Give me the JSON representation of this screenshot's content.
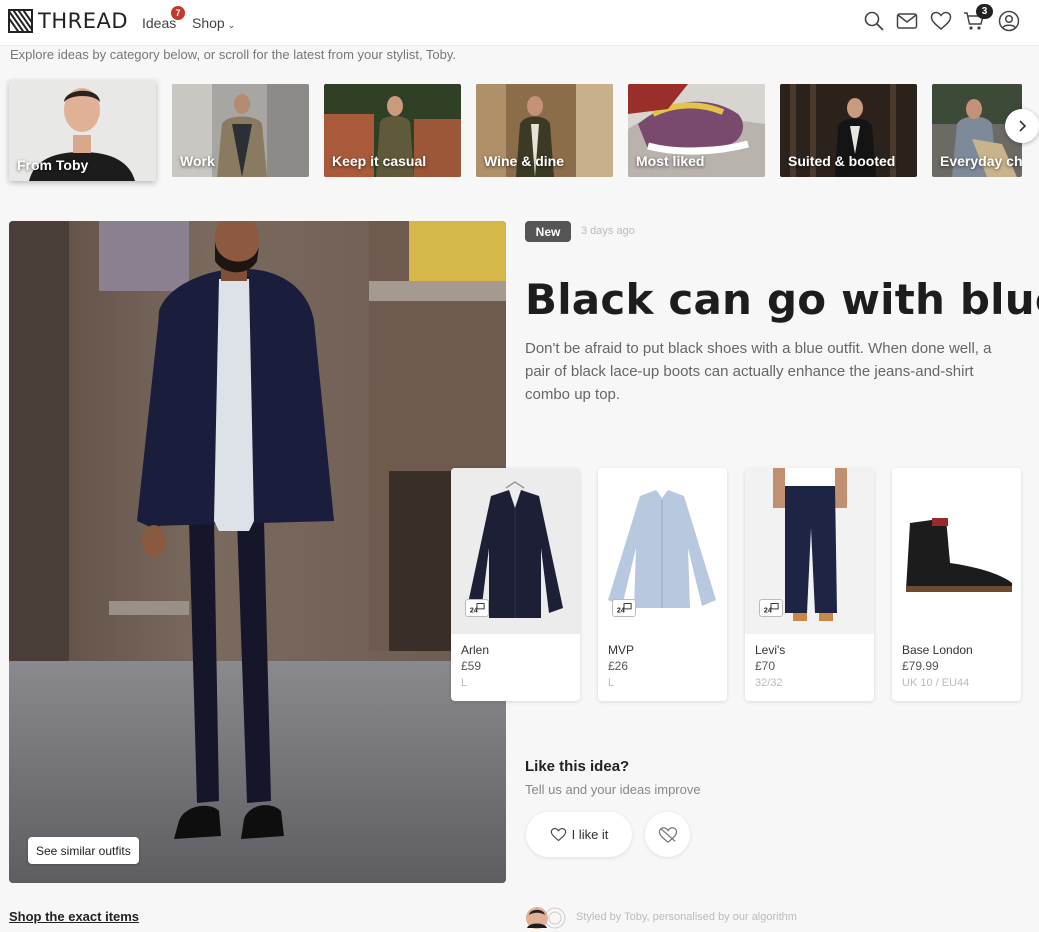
{
  "header": {
    "logo_text": "THREAD",
    "nav": {
      "ideas_label": "Ideas",
      "ideas_badge": "7",
      "shop_label": "Shop"
    },
    "icons": [
      "search-icon",
      "mail-icon",
      "heart-icon",
      "cart-icon",
      "account-icon"
    ],
    "cart_count": "3"
  },
  "subtext": "Explore ideas by category below, or scroll for the latest from your stylist, Toby.",
  "categories": [
    {
      "label": "From Toby"
    },
    {
      "label": "Work"
    },
    {
      "label": "Keep it casual"
    },
    {
      "label": "Wine & dine"
    },
    {
      "label": "Most liked"
    },
    {
      "label": "Suited & booted"
    },
    {
      "label": "Everyday chi"
    }
  ],
  "hero": {
    "similar_label": "See similar outfits"
  },
  "article": {
    "badge": "New",
    "time_ago": "3 days ago",
    "title": "Black can go with blue",
    "description": "Don't be afraid to put black shoes with a blue outfit. When done well, a pair of black lace-up boots can actually enhance the jeans-and-shirt combo up top."
  },
  "products": [
    {
      "brand": "Arlen",
      "price": "£59",
      "size": "L"
    },
    {
      "brand": "MVP",
      "price": "£26",
      "size": "L"
    },
    {
      "brand": "Levi's",
      "price": "£70",
      "size": "32/32"
    },
    {
      "brand": "Base London",
      "price": "£79.99",
      "size": "UK 10 / EU44"
    }
  ],
  "feedback": {
    "title": "Like this idea?",
    "subtitle": "Tell us and your ideas improve",
    "like_label": "I like it"
  },
  "footer": {
    "shop_exact": "Shop the exact items",
    "styled_by": "Styled by Toby, personalised by our algorithm"
  },
  "colors": {
    "badge_red": "#c0392b",
    "text_dark": "#1d1d1d",
    "muted": "#777777",
    "background": "#f7f7f7"
  }
}
